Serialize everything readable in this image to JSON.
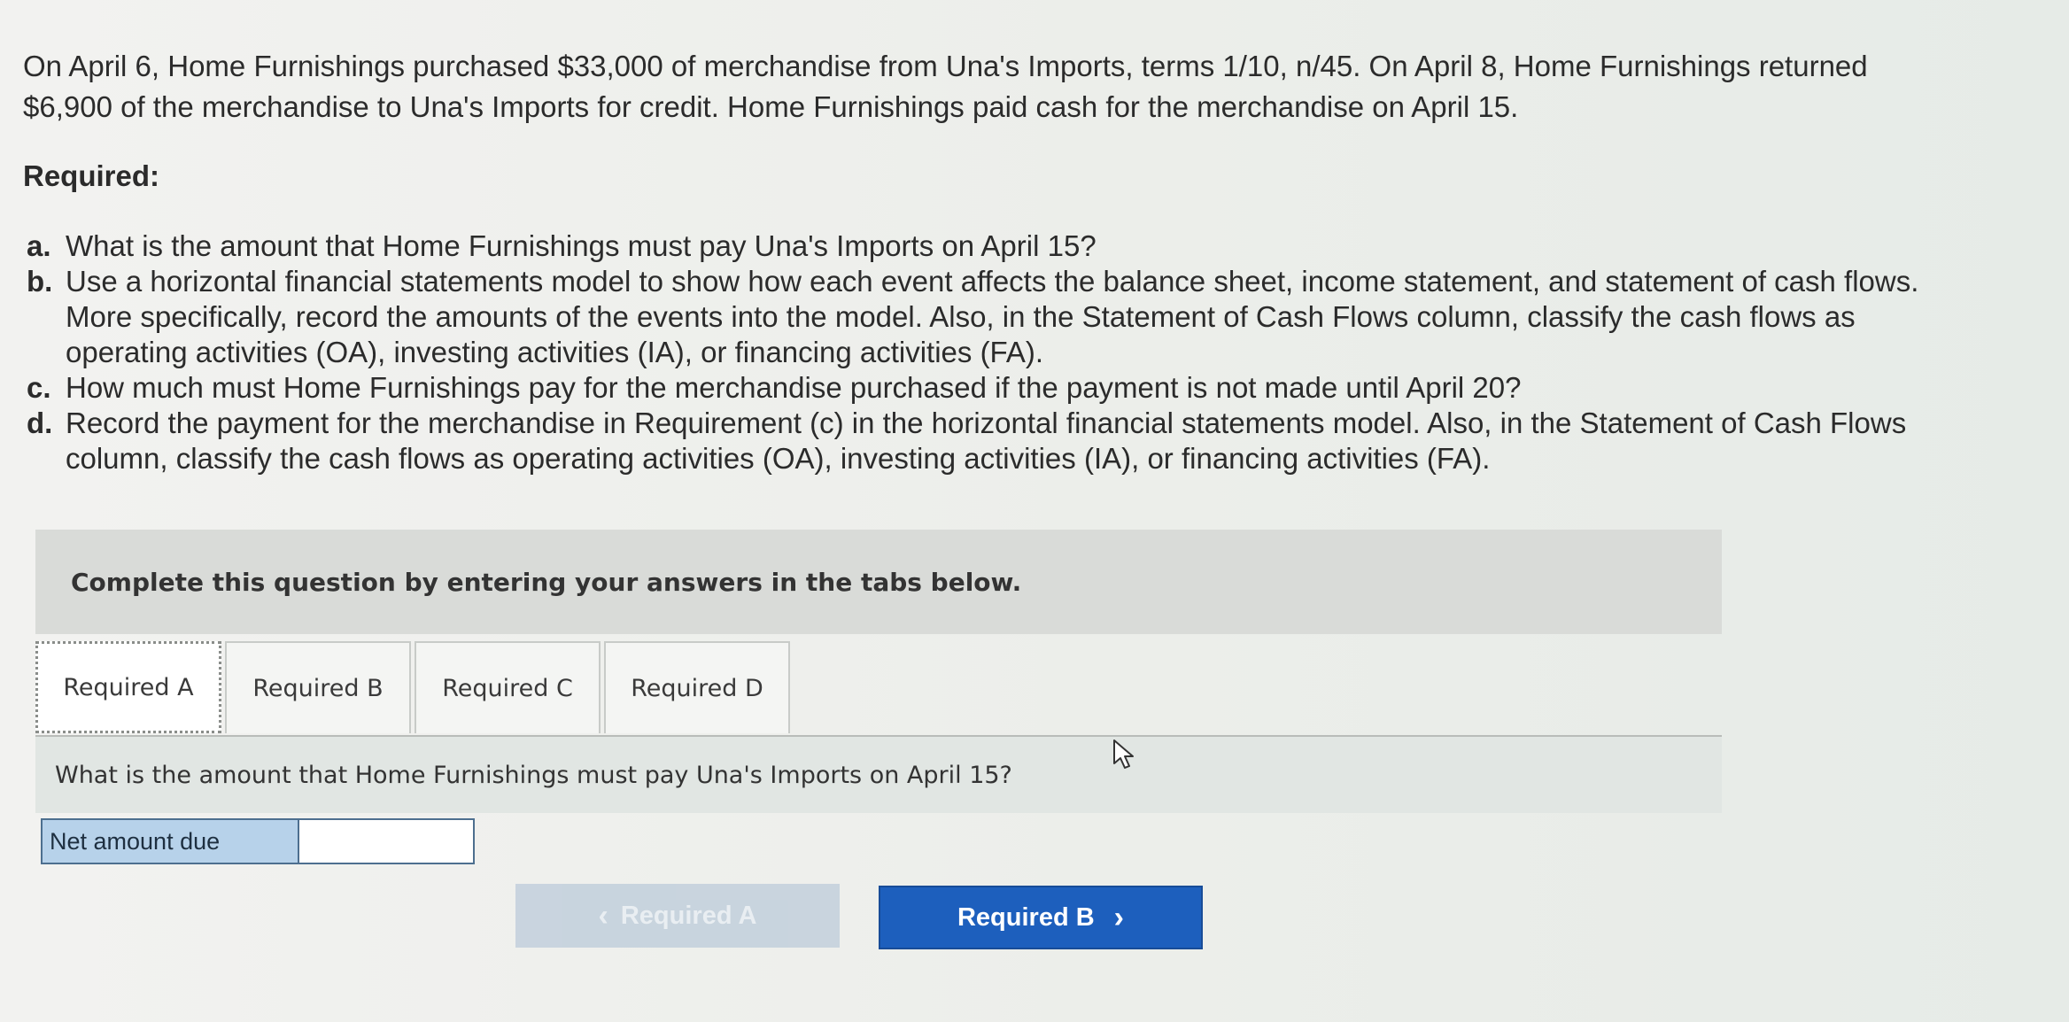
{
  "problem": {
    "intro": "On April 6, Home Furnishings purchased $33,000 of merchandise from Una's Imports, terms 1/10, n/45. On April 8, Home Furnishings returned $6,900 of the merchandise to Una's Imports for credit. Home Furnishings paid cash for the merchandise on April 15.",
    "required_heading": "Required:",
    "requirements": [
      {
        "letter": "a.",
        "text": "What is the amount that Home Furnishings must pay Una's Imports on April 15?"
      },
      {
        "letter": "b.",
        "text": "Use a horizontal financial statements model to show how each event affects the balance sheet, income statement, and statement of cash flows. More specifically, record the amounts of the events into the model. Also, in the Statement of Cash Flows column, classify the cash flows as operating activities (OA), investing activities (IA), or financing activities (FA)."
      },
      {
        "letter": "c.",
        "text": "How much must Home Furnishings pay for the merchandise purchased if the payment is not made until April 20?"
      },
      {
        "letter": "d.",
        "text": "Record the payment for the merchandise in Requirement (c) in the horizontal financial statements model. Also, in the Statement of Cash Flows column, classify the cash flows as operating activities (OA), investing activities (IA), or financing activities (FA)."
      }
    ]
  },
  "instructions": "Complete this question by entering your answers in the tabs below.",
  "tabs": [
    {
      "label": "Required A",
      "active": true
    },
    {
      "label": "Required B",
      "active": false
    },
    {
      "label": "Required C",
      "active": false
    },
    {
      "label": "Required D",
      "active": false
    }
  ],
  "question": "What is the amount that Home Furnishings must pay Una's Imports on April 15?",
  "answer": {
    "label": "Net amount due",
    "value": ""
  },
  "nav": {
    "prev_label": "Required A",
    "next_label": "Required B",
    "prev_icon": "chevron-left-icon",
    "next_icon": "chevron-right-icon"
  },
  "colors": {
    "primary_button": "#1d5fbd",
    "answer_label_bg": "#b7d2ea",
    "instruction_band": "#d9dbd8"
  }
}
